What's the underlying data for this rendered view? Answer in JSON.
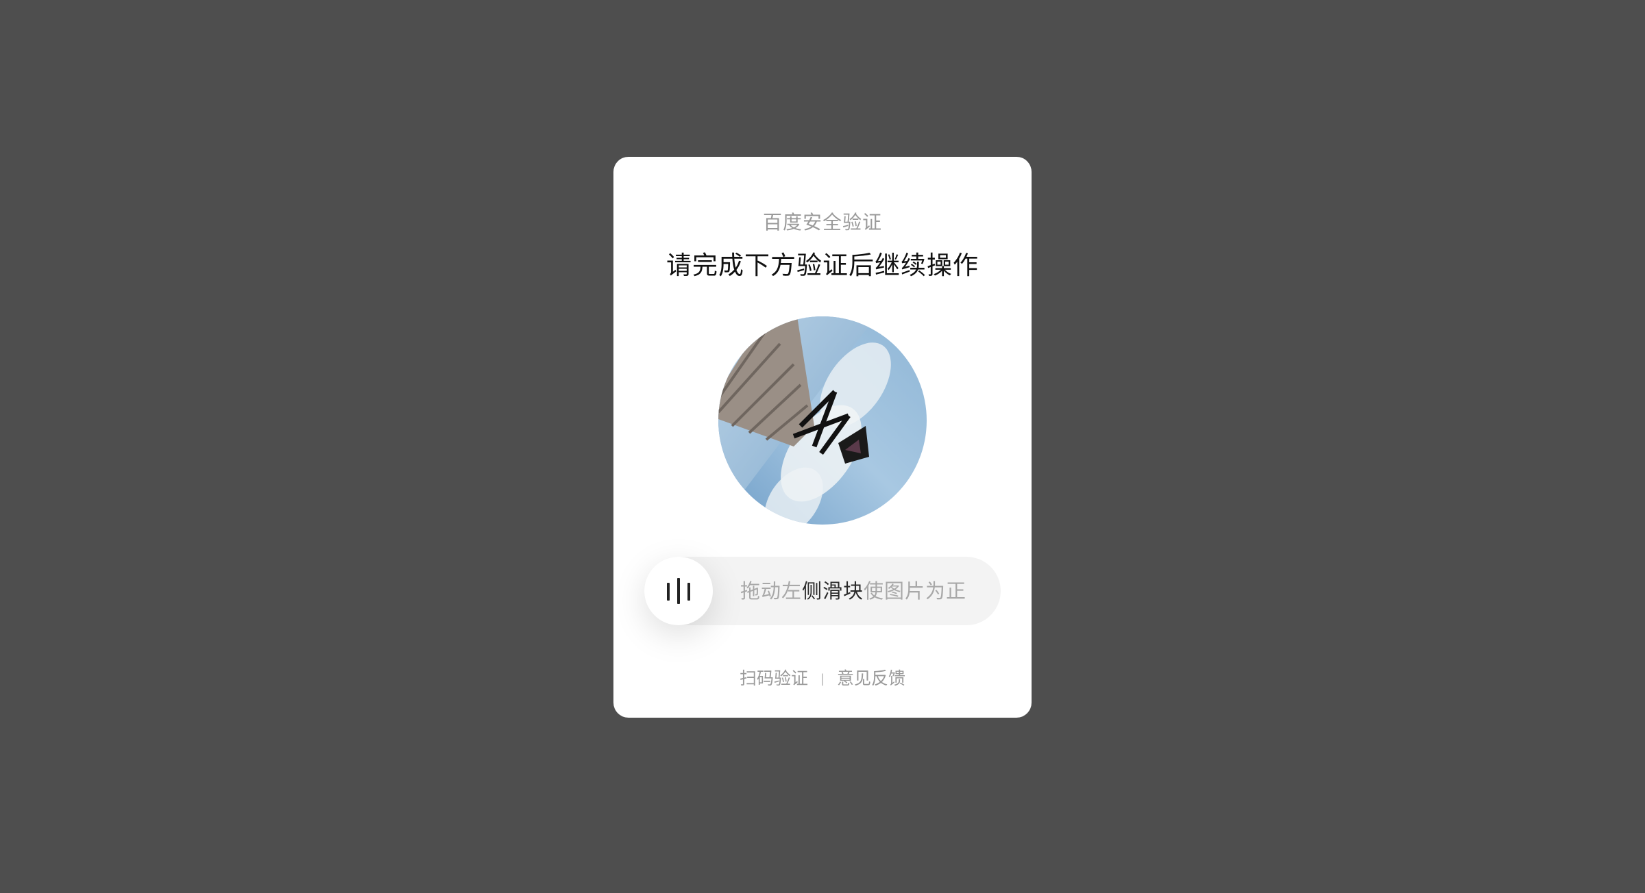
{
  "dialog": {
    "subtitle": "百度安全验证",
    "title": "请完成下方验证后继续操作"
  },
  "slider": {
    "hint_before": "拖动左",
    "hint_highlight": "侧滑块",
    "hint_after": "使图片为正",
    "thumb_icon": "grip-bars-icon"
  },
  "footer": {
    "scan_label": "扫码验证",
    "separator": "|",
    "feedback_label": "意见反馈"
  },
  "colors": {
    "overlay": "#4e4e4e",
    "dialog": "#ffffff",
    "track": "#f3f3f3",
    "hint_text": "#a8a8a8",
    "title_text": "#111111"
  }
}
